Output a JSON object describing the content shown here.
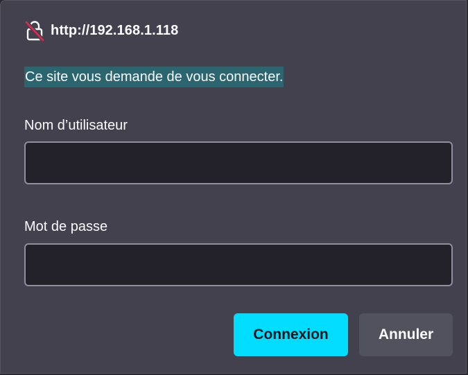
{
  "dialog": {
    "origin": "http://192.168.1.118",
    "message": "Ce site vous demande de vous connecter.",
    "username": {
      "label": "Nom d’utilisateur",
      "value": "",
      "placeholder": ""
    },
    "password": {
      "label": "Mot de passe",
      "value": "",
      "placeholder": ""
    },
    "buttons": {
      "login": "Connexion",
      "cancel": "Annuler"
    }
  },
  "icons": {
    "origin_security": "insecure-lock-icon"
  },
  "colors": {
    "dialog_background": "#42414d",
    "field_background": "#23222b",
    "primary_button": "#00ddff",
    "secondary_button": "#52525e",
    "message_highlight": "#2a6570",
    "insecure_slash": "#e22850"
  }
}
